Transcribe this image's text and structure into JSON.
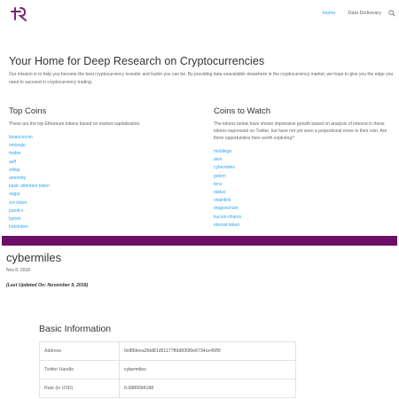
{
  "header": {
    "nav": [
      {
        "label": "Home",
        "active": true
      },
      {
        "label": "Data Dictionary",
        "active": false
      }
    ],
    "logo_icon": "crypto-logo-icon",
    "search_icon": "search-icon",
    "accent_color": "#2ea3f2",
    "logo_color": "#7b2478"
  },
  "hero": {
    "title": "Your Home for Deep Research on Cryptocurrencies",
    "text": "Our mission is to help you become the best cryptocurrency investor and trader you can be. By providing data unavailable elsewhere in the cryptocurrency market, we hope to give you the edge you need to succeed in cryptocurrency trading."
  },
  "top_coins": {
    "title": "Top Coins",
    "description": "These are the top Ethereum tokens based on market capitalization.",
    "items": [
      "binancecoin",
      "omisego",
      "maker",
      "aelf",
      "zilliqa",
      "aeternity",
      "basic attention token",
      "augur",
      "zrx-token",
      "pundi-x",
      "bytom",
      "holotoken"
    ]
  },
  "coins_to_watch": {
    "title": "Coins to Watch",
    "description": "The tokens below have shown impressive growth based on analysis of interest in these tokens expressed on Twitter, but have not yet seen a proportional move in their coin. Are there opportunities here worth exploring?",
    "items": [
      "mobilego",
      "aion",
      "cybermiles",
      "golem",
      "tenx",
      "status",
      "chainlink",
      "dragonchain",
      "kucoin-shares",
      "eternal-token"
    ]
  },
  "band_color": "#6d0f66",
  "post": {
    "title": "cybermiles",
    "date": "Nov 8, 2018",
    "updated": "(Last Updated On: November 9, 2018)"
  },
  "basic_info": {
    "title": "Basic Information",
    "rows": [
      {
        "key": "Address",
        "value": "0xf85feea2fdd81d51177f6b8f35f0e6734ce45f5f"
      },
      {
        "key": "Twitter Handle",
        "value": "cybermiles"
      },
      {
        "key": "Rate (in USD)",
        "value": "0.0880094188"
      }
    ]
  }
}
